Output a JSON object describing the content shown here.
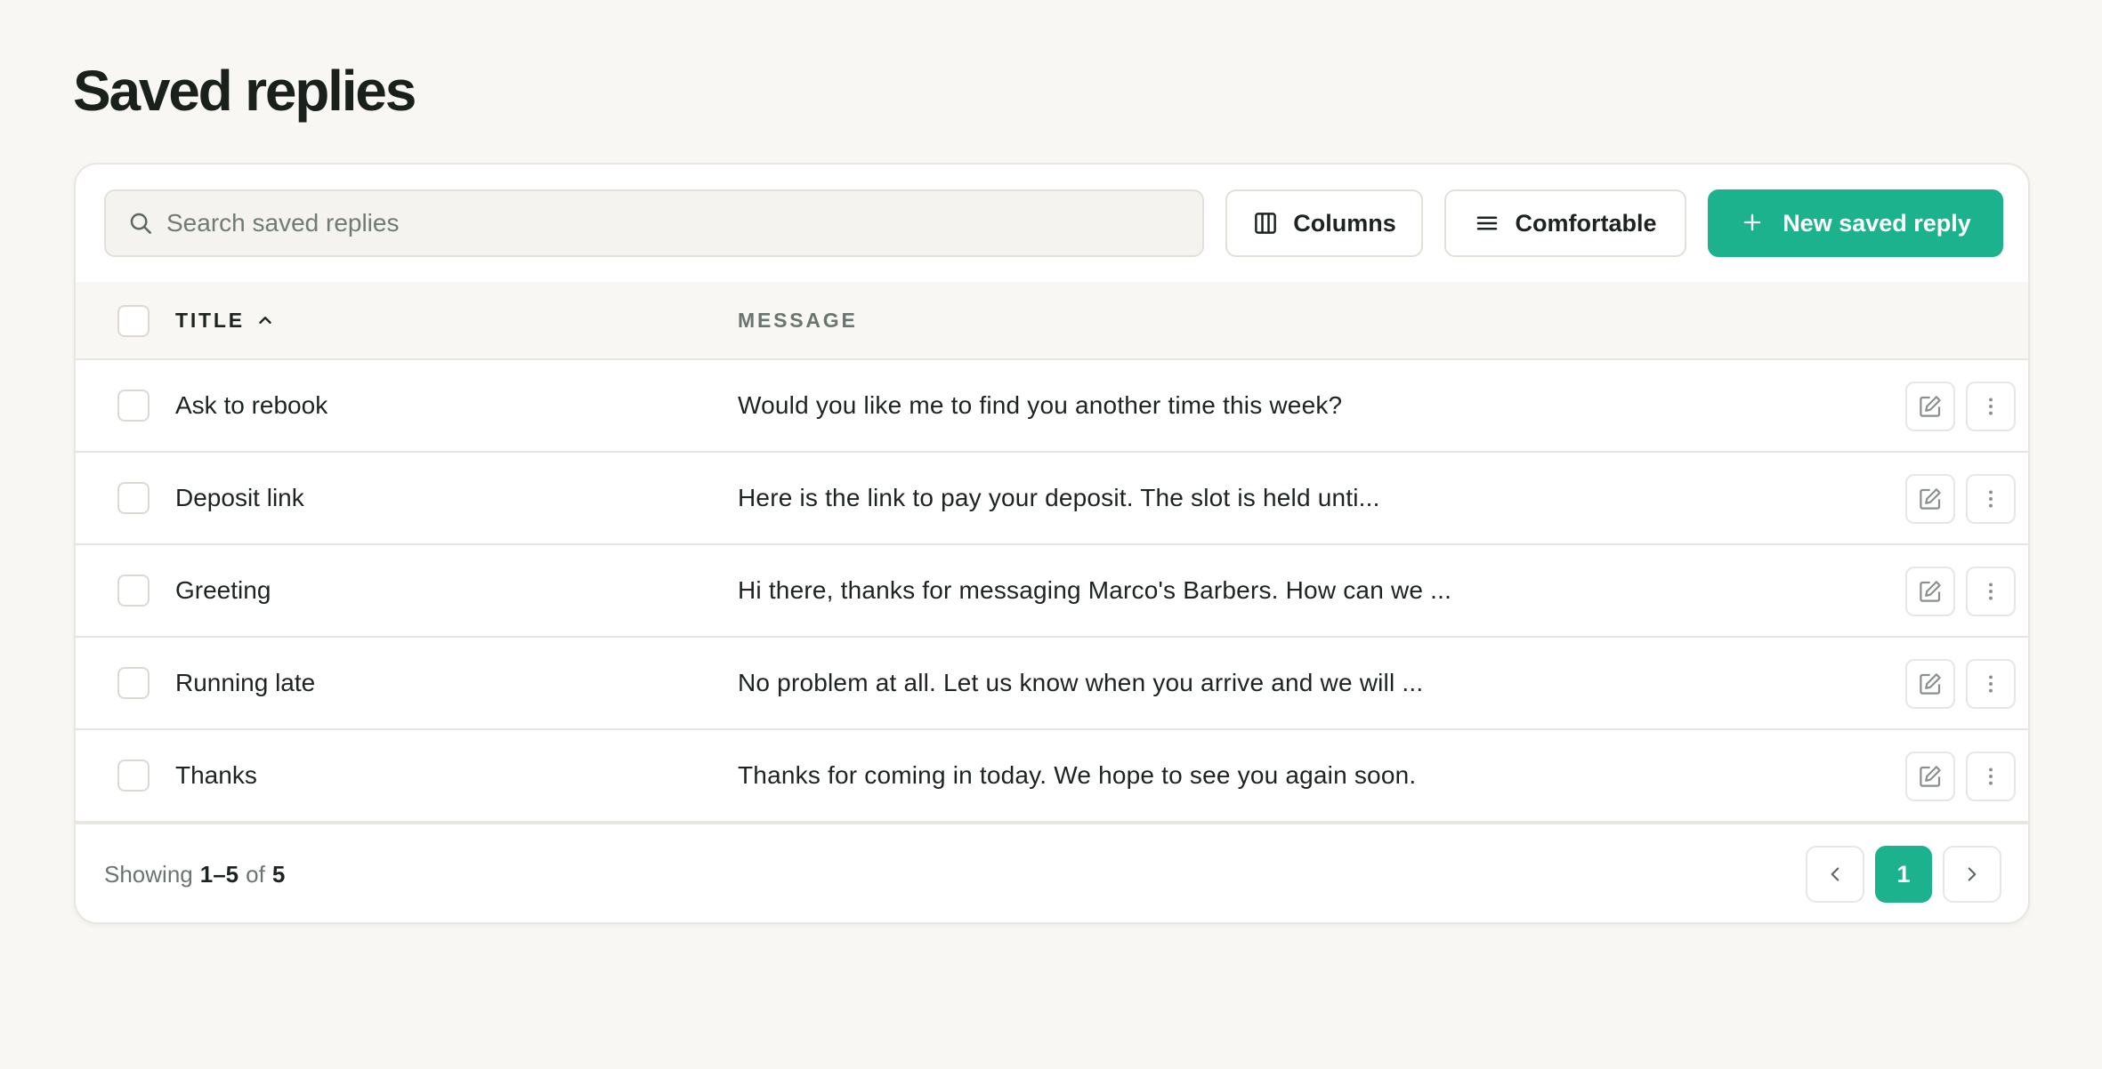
{
  "page": {
    "title": "Saved replies"
  },
  "toolbar": {
    "search_placeholder": "Search saved replies",
    "columns_label": "Columns",
    "density_label": "Comfortable",
    "new_label": "New saved reply"
  },
  "table": {
    "columns": [
      {
        "label": "TITLE",
        "sort": "ascending"
      },
      {
        "label": "MESSAGE"
      }
    ],
    "rows": [
      {
        "title": "Ask to rebook",
        "message": "Would you like me to find you another time this week?"
      },
      {
        "title": "Deposit link",
        "message": "Here is the link to pay your deposit. The slot is held unti..."
      },
      {
        "title": "Greeting",
        "message": "Hi there, thanks for messaging Marco's Barbers. How can we ..."
      },
      {
        "title": "Running late",
        "message": "No problem at all. Let us know when you arrive and we will ..."
      },
      {
        "title": "Thanks",
        "message": "Thanks for coming in today. We hope to see you again soon."
      }
    ]
  },
  "footer": {
    "showing_prefix": "Showing",
    "range": "1–5",
    "of_label": "of",
    "total": "5",
    "current_page": "1"
  },
  "colors": {
    "accent": "#1db28e",
    "background": "#f9f7f3",
    "text": "#1d2420",
    "muted": "#6b7570"
  },
  "icons": {
    "search": "search-icon",
    "columns": "columns-icon",
    "density": "menu-lines-icon",
    "new": "plus-icon",
    "sort": "chevron-up-icon",
    "edit": "edit-icon",
    "more": "more-vertical-icon",
    "prev": "chevron-left-icon",
    "next": "chevron-right-icon"
  }
}
